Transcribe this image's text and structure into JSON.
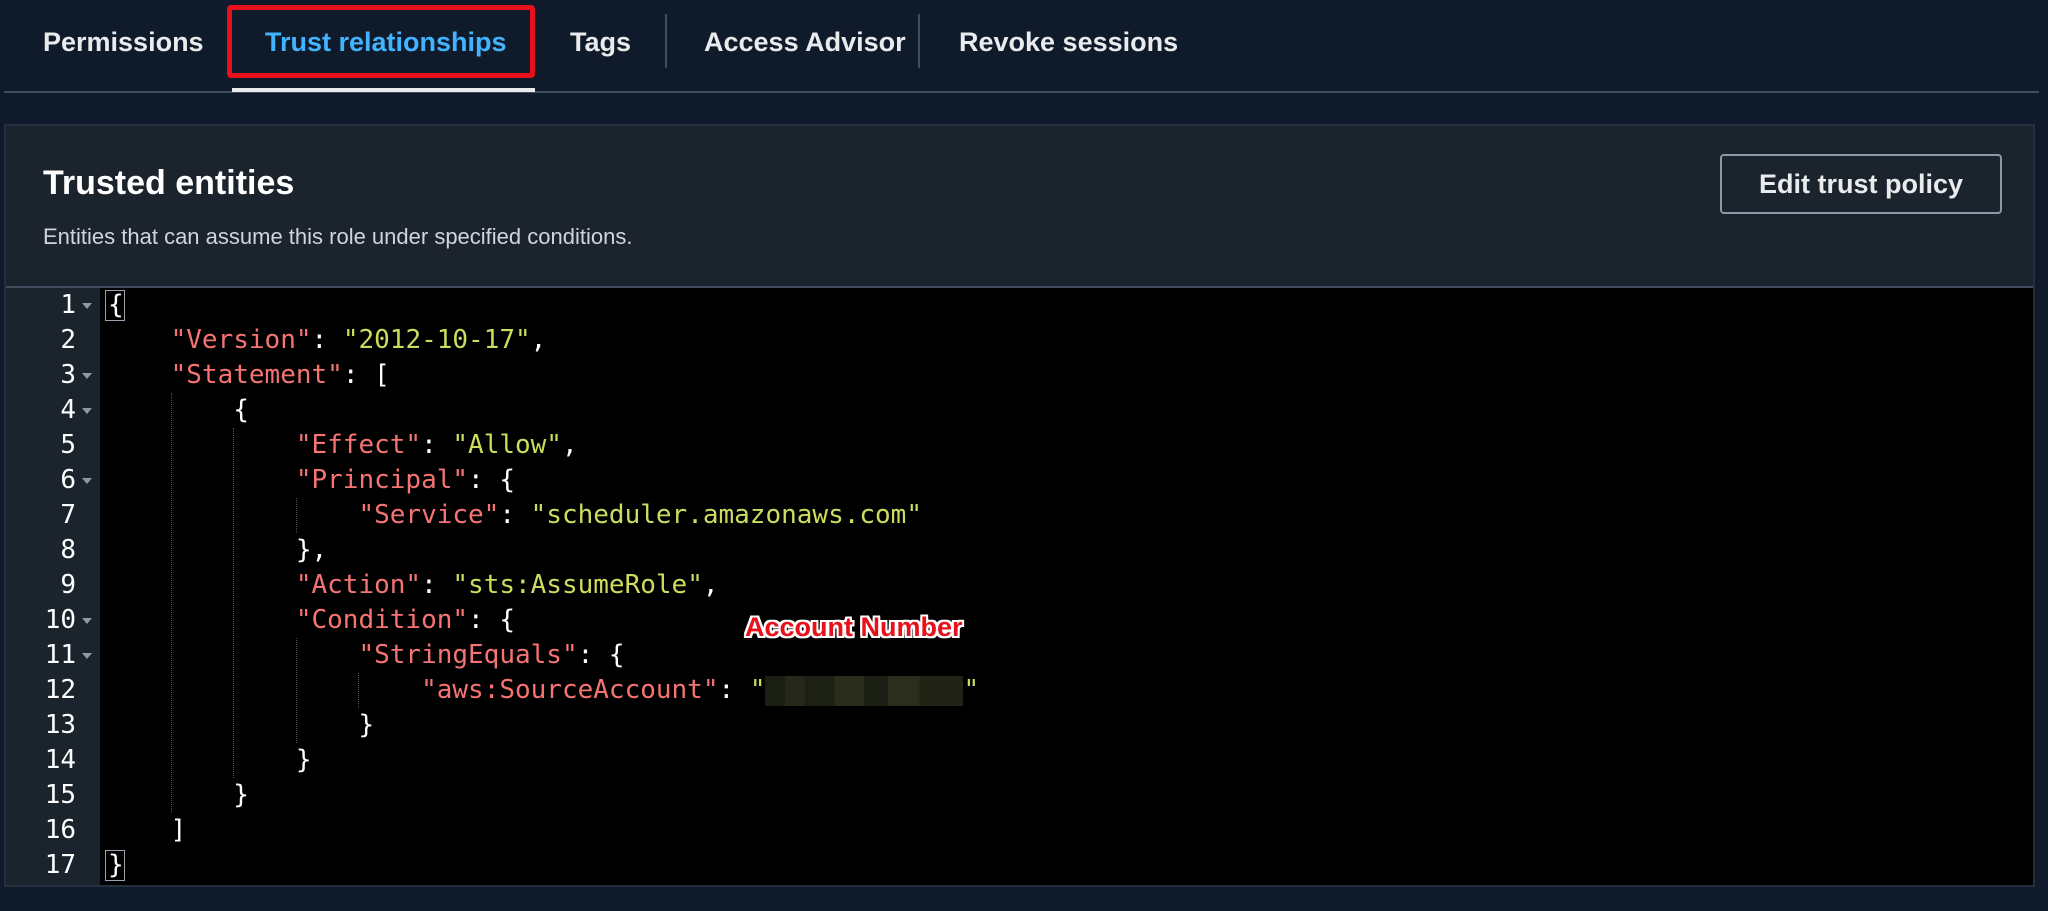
{
  "tabs": {
    "permissions": "Permissions",
    "trust_relationships": "Trust relationships",
    "tags": "Tags",
    "access_advisor": "Access Advisor",
    "revoke_sessions": "Revoke sessions",
    "active": "Trust relationships"
  },
  "trusted_entities": {
    "title": "Trusted entities",
    "description": "Entities that can assume this role under specified conditions.",
    "edit_button": "Edit trust policy"
  },
  "editor": {
    "line_numbers": [
      "1",
      "2",
      "3",
      "4",
      "5",
      "6",
      "7",
      "8",
      "9",
      "10",
      "11",
      "12",
      "13",
      "14",
      "15",
      "16",
      "17"
    ],
    "lines": [
      {
        "open": "{"
      },
      {
        "key": "\"Version\"",
        "sep": ": ",
        "value": "\"2012-10-17\"",
        "tail": ","
      },
      {
        "key": "\"Statement\"",
        "sep": ": ",
        "tail": "["
      },
      {
        "open": "{"
      },
      {
        "key": "\"Effect\"",
        "sep": ": ",
        "value": "\"Allow\"",
        "tail": ","
      },
      {
        "key": "\"Principal\"",
        "sep": ": ",
        "tail": "{"
      },
      {
        "key": "\"Service\"",
        "sep": ": ",
        "value": "\"scheduler.amazonaws.com\""
      },
      {
        "open": "},"
      },
      {
        "key": "\"Action\"",
        "sep": ": ",
        "value": "\"sts:AssumeRole\"",
        "tail": ","
      },
      {
        "key": "\"Condition\"",
        "sep": ": ",
        "tail": "{"
      },
      {
        "key": "\"StringEquals\"",
        "sep": ": ",
        "tail": "{"
      },
      {
        "key": "\"aws:SourceAccount\"",
        "sep": ": ",
        "value_open": "\"",
        "value_close": "\""
      },
      {
        "open": "}"
      },
      {
        "open": "}"
      },
      {
        "open": "}"
      },
      {
        "open": "]"
      },
      {
        "open": "}"
      }
    ]
  },
  "annotation": "Account Number",
  "colors": {
    "active_tab": "#42b4ff",
    "json_key": "#f57373",
    "json_string": "#cddc5c",
    "highlight": "#e8101a"
  }
}
